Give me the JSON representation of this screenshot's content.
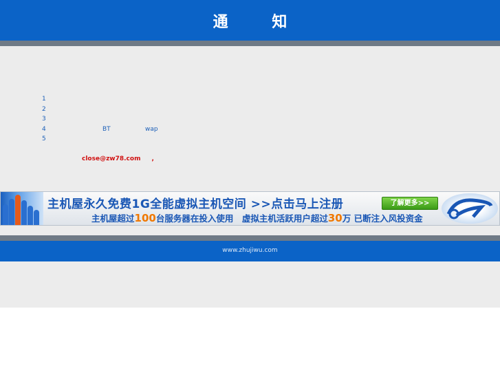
{
  "header": {
    "title": "通 知"
  },
  "list": {
    "items": [
      {
        "number": "1",
        "extra": []
      },
      {
        "number": "2",
        "extra": []
      },
      {
        "number": "3",
        "extra": []
      },
      {
        "number": "4",
        "extra": [
          "BT",
          "wap"
        ]
      },
      {
        "number": "5",
        "extra": []
      }
    ]
  },
  "notice": {
    "email": "close@zw78.com",
    "comma": ","
  },
  "banner": {
    "line1": "主机屋永久免费1G全能虚拟主机空间 >>点击马上注册",
    "line2_part1": "主机屋超过",
    "line2_num1": "100",
    "line2_part2": "台服务器在投入使用　虚拟主机活跃用户超过",
    "line2_num2": "30",
    "line2_part3": "万 已断注入风投资金",
    "button": "了解更多>>"
  },
  "footer": {
    "site": "www.zhujiwu.com"
  },
  "colors": {
    "header_blue": "#0b63c7",
    "notice_red": "#d01010",
    "link_blue": "#1c5fb8"
  }
}
